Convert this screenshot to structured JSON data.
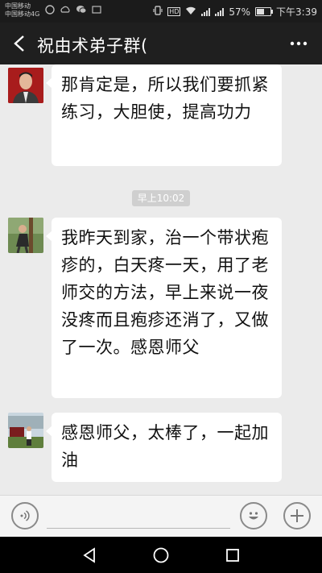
{
  "status_bar": {
    "carrier_line1": "中国移动",
    "carrier_line2": "中国移动4G",
    "hd_label": "HD",
    "battery_percent": "57%",
    "battery_level": 0.57,
    "time": "下午3:39"
  },
  "header": {
    "title": "祝由术弟子群(",
    "back_icon": "chevron-left-icon",
    "more_icon": "more-dots-icon"
  },
  "messages": [
    {
      "sender_avatar": "avatar-man-red-background",
      "text": "那肯定是，所以我们要抓紧练习，大胆使，提高功力"
    },
    {
      "sender_avatar": "avatar-man-outdoors-tree",
      "text": "我昨天到家，治一个带状疱疹的，白天疼一天，用了老师交的方法，早上来说一夜没疼而且疱疹还消了，又做了一次。感恩师父"
    },
    {
      "sender_avatar": "avatar-man-standing-building",
      "text": "感恩师父，太棒了，一起加油"
    }
  ],
  "timestamp": "早上10:02",
  "input_bar": {
    "voice_icon": "voice-icon",
    "emoji_icon": "emoji-icon",
    "plus_icon": "plus-icon"
  },
  "nav_bar": {
    "back_icon": "nav-back-icon",
    "home_icon": "nav-home-icon",
    "recents_icon": "nav-recents-icon"
  },
  "colors": {
    "header_bg": "#1f1f1f",
    "chat_bg": "#ebebeb",
    "bubble_bg": "#ffffff",
    "time_badge_bg": "#cfcfcf"
  }
}
